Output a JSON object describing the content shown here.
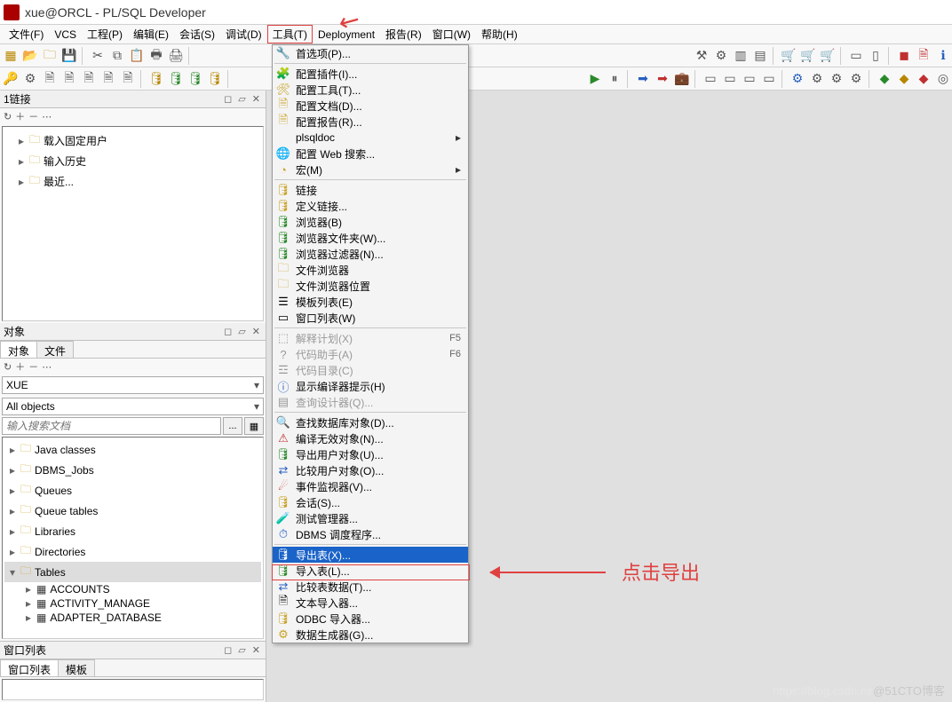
{
  "title": "xue@ORCL - PL/SQL Developer",
  "menu": {
    "file": "文件(F)",
    "vcs": "VCS",
    "project": "工程(P)",
    "edit": "编辑(E)",
    "session": "会话(S)",
    "debug": "调试(D)",
    "tools": "工具(T)",
    "deployment": "Deployment",
    "report": "报告(R)",
    "window": "窗口(W)",
    "help": "帮助(H)"
  },
  "panels": {
    "connections_title": "1链接",
    "objects_title": "对象",
    "window_list_title": "窗口列表",
    "controls": "◻ ▱ ✕"
  },
  "conn_tree": {
    "n1": "载入固定用户",
    "n2": "输入历史",
    "n3": "最近..."
  },
  "obj_tabs": {
    "objects": "对象",
    "files": "文件"
  },
  "user_combo": "XUE",
  "filter_combo": "All objects",
  "search_placeholder": "输入搜索文档",
  "obj_tree": {
    "n1": "Java classes",
    "n2": "DBMS_Jobs",
    "n3": "Queues",
    "n4": "Queue tables",
    "n5": "Libraries",
    "n6": "Directories",
    "n7": "Tables",
    "t1": "ACCOUNTS",
    "t2": "ACTIVITY_MANAGE",
    "t3": "ADAPTER_DATABASE"
  },
  "wl_tabs": {
    "list": "窗口列表",
    "template": "模板"
  },
  "dropdown": {
    "preferences": "首选项(P)...",
    "cfg_plugins": "配置插件(I)...",
    "cfg_tools": "配置工具(T)...",
    "cfg_docs": "配置文档(D)...",
    "cfg_reports": "配置报告(R)...",
    "plsqldoc": "plsqldoc",
    "cfg_web": "配置 Web 搜索...",
    "macro": "宏(M)",
    "link": "链接",
    "def_link": "定义链接...",
    "browser": "浏览器(B)",
    "browser_folder": "浏览器文件夹(W)...",
    "browser_filter": "浏览器过滤器(N)...",
    "file_browser": "文件浏览器",
    "file_browser_loc": "文件浏览器位置",
    "template_list": "模板列表(E)",
    "window_list": "窗口列表(W)",
    "explain": "解释计划(X)",
    "explain_sc": "F5",
    "code_assist": "代码助手(A)",
    "code_assist_sc": "F6",
    "code_dir": "代码目录(C)",
    "compiler_hint": "显示编译器提示(H)",
    "query_designer": "查询设计器(Q)...",
    "find_db_obj": "查找数据库对象(D)...",
    "compile_invalid": "编译无效对象(N)...",
    "export_user": "导出用户对象(U)...",
    "compare_user": "比较用户对象(O)...",
    "event_monitor": "事件监视器(V)...",
    "session_menu": "会话(S)...",
    "test_manager": "测试管理器...",
    "dbms_scheduler": "DBMS 调度程序...",
    "export_tables": "导出表(X)...",
    "import_tables": "导入表(L)...",
    "compare_table_data": "比较表数据(T)...",
    "text_importer": "文本导入器...",
    "odbc_importer": "ODBC 导入器...",
    "data_generator": "数据生成器(G)..."
  },
  "annotation": {
    "click_export": "点击导出"
  },
  "watermark": {
    "faint": "https://blog.csdn.ne",
    "strong": "@51CTO博客"
  }
}
